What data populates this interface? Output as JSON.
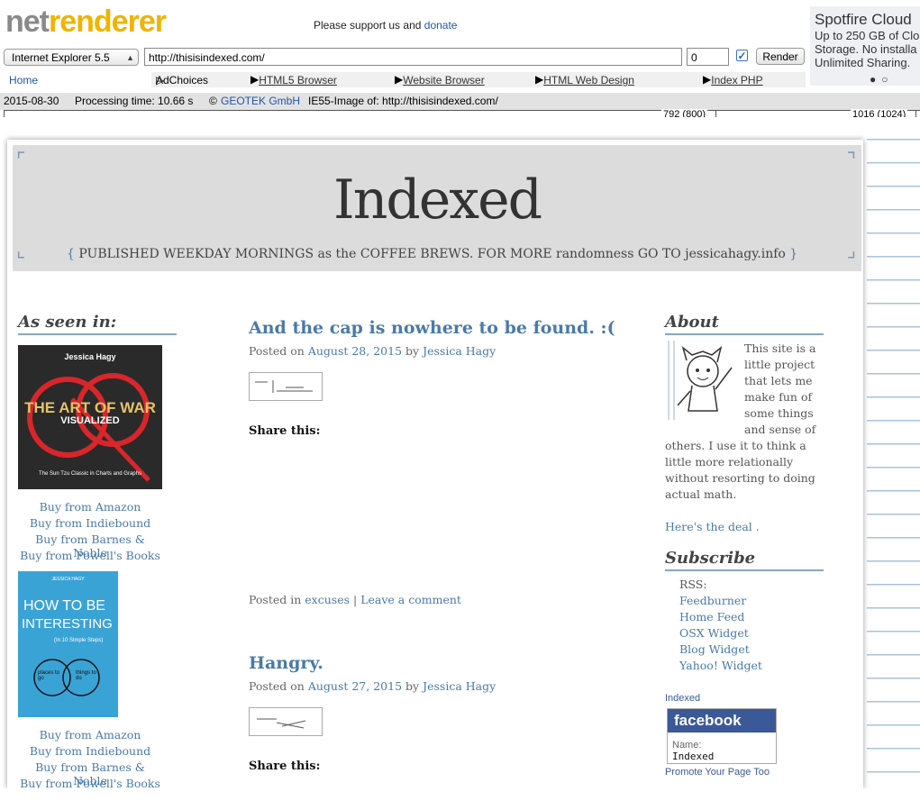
{
  "toolbar": {
    "logo_net": "net",
    "logo_renderer": "renderer",
    "support_text": "Please support us and",
    "donate_label": "donate",
    "browser_select": "Internet Explorer 5.5",
    "url_value": "http://thisisindexed.com/",
    "delay_value": "0",
    "render_label": "Render",
    "home_label": "Home",
    "adchoices_label": "AdChoices",
    "nav_links": [
      "HTML5 Browser",
      "Website Browser",
      "HTML Web Design",
      "Index PHP"
    ]
  },
  "ad": {
    "title": "Spotfire Cloud",
    "lines": [
      "Up to 250 GB of Clo",
      "Storage. No installa",
      "Unlimited Sharing."
    ]
  },
  "infobar": {
    "date": "2015-08-30",
    "processing": "Processing time: 10.66 s",
    "copyright": "©",
    "company": "GEOTEK GmbH",
    "image_of": "IE55-Image of: http://thisisindexed.com/"
  },
  "ruler": {
    "mark1": "792 (800)",
    "mark2": "1016 (1024)"
  },
  "site": {
    "title": "Indexed",
    "tagline_open": "{",
    "tagline": "PUBLISHED WEEKDAY MORNINGS as the COFFEE BREWS. FOR MORE randomness GO TO jessicahagy.info",
    "tagline_close": "}"
  },
  "left": {
    "title": "As seen in:",
    "book1": {
      "author": "Jessica Hagy",
      "title_line1": "THE ART OF WAR",
      "title_line2": "VISUALIZED",
      "subtitle": "The Sun Tzu Classic in Charts and Graphs"
    },
    "book1_links": [
      "Buy from Amazon",
      "Buy from Indiebound",
      "Buy from Barnes & Noble",
      "Buy from Powell's Books"
    ],
    "book2": {
      "author": "JESSICA HAGY",
      "title_line1": "HOW TO BE",
      "title_line2": "INTERESTING",
      "subtitle": "(In 10 Simple Steps)",
      "circle_a": "places to go",
      "circle_b": "things to do"
    },
    "book2_links": [
      "Buy from Amazon",
      "Buy from Indiebound",
      "Buy from Barnes & Noble",
      "Buy from Powell's Books"
    ]
  },
  "posts": [
    {
      "title": "And the cap is nowhere to be found. :(",
      "posted_on": "Posted on",
      "date": "August 28, 2015",
      "by": "by",
      "author": "Jessica Hagy",
      "share": "Share this:",
      "posted_in": "Posted in",
      "category": "excuses",
      "sep": "|",
      "comment": "Leave a comment"
    },
    {
      "title": "Hangry.",
      "posted_on": "Posted on",
      "date": "August 27, 2015",
      "by": "by",
      "author": "Jessica Hagy",
      "share": "Share this:"
    }
  ],
  "right": {
    "about_title": "About",
    "about_lines": [
      "This site is a",
      "little project",
      "that lets me",
      "make fun of",
      "some things",
      "and sense of"
    ],
    "about_rest": [
      "others. I use it to think a",
      "little more relationally",
      "without resorting to doing",
      "actual math."
    ],
    "deal_link": "Here's the deal .",
    "subscribe_title": "Subscribe",
    "rss_label": "RSS:",
    "feeds": [
      "Feedburner",
      "Home Feed",
      "OSX Widget",
      "Blog Widget",
      "Yahoo! Widget"
    ],
    "fb_page_link": "Indexed",
    "fb_logo": "facebook",
    "fb_name_label": "Name:",
    "fb_name_value": "Indexed",
    "fb_promote": "Promote Your Page Too"
  },
  "colors": {
    "logo_gray": "#8a8a8a",
    "logo_yellow": "#f0b400",
    "link_blue": "#4a7aa8",
    "header_bg": "#dcdcdc",
    "facebook_blue": "#3b5998"
  }
}
